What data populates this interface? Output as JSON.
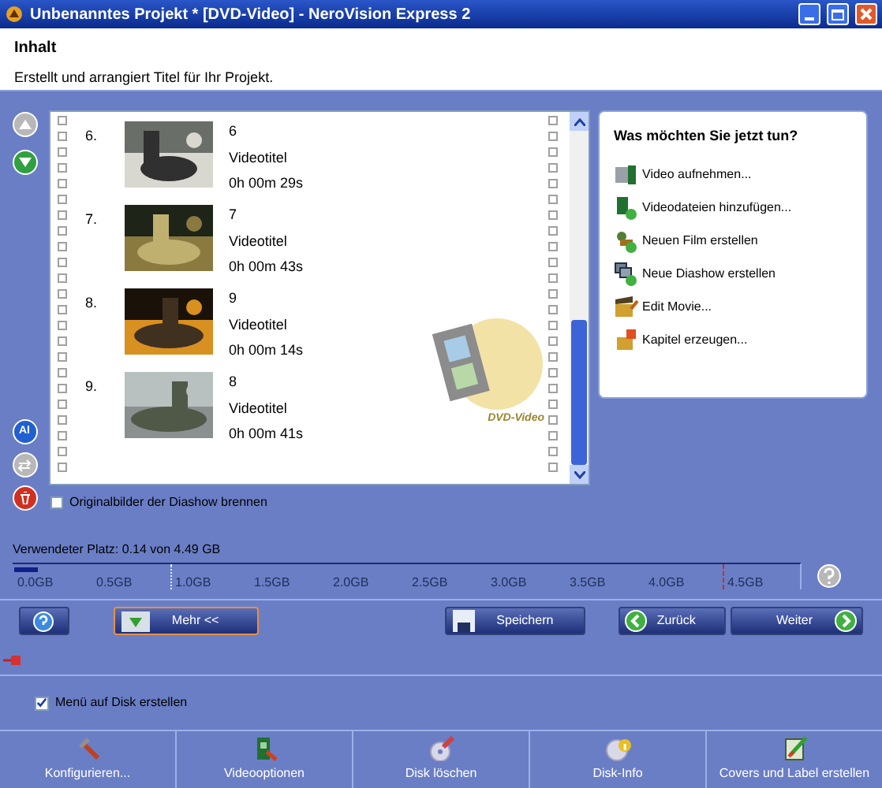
{
  "window": {
    "title": "Unbenanntes Projekt * [DVD-Video] - NeroVision Express 2"
  },
  "header": {
    "title": "Inhalt",
    "subtitle": "Erstellt und arrangiert Titel für Ihr Projekt."
  },
  "left_tools": [
    {
      "kind": "up",
      "disabled": true
    },
    {
      "kind": "down",
      "disabled": false
    },
    {
      "kind": "auto",
      "label": "AI",
      "disabled": false
    },
    {
      "kind": "swap",
      "disabled": true
    },
    {
      "kind": "delete",
      "disabled": false
    }
  ],
  "titles": [
    {
      "number": "6.",
      "name": "6",
      "type": "Videotitel",
      "duration": "0h 00m 29s"
    },
    {
      "number": "7.",
      "name": "7",
      "type": "Videotitel",
      "duration": "0h 00m 43s"
    },
    {
      "number": "8.",
      "name": "9",
      "type": "Videotitel",
      "duration": "0h 00m 14s"
    },
    {
      "number": "9.",
      "name": "8",
      "type": "Videotitel",
      "duration": "0h 00m 41s"
    }
  ],
  "list_logo": {
    "text": "DVD-Video"
  },
  "slideshow_option": {
    "label": "Originalbilder der Diashow brennen",
    "checked": false
  },
  "tasks": {
    "title": "Was möchten Sie jetzt tun?",
    "items": [
      "Video aufnehmen...",
      "Videodateien hinzufügen...",
      "Neuen Film erstellen",
      "Neue Diashow erstellen",
      "Edit Movie...",
      "Kapitel erzeugen..."
    ]
  },
  "disc_usage": {
    "label": "Verwendeter Platz: 0.14 von 4.49 GB",
    "level": 0.03,
    "scale_labels": [
      "0.0GB",
      "0.5GB",
      "1.0GB",
      "1.5GB",
      "2.0GB",
      "2.5GB",
      "3.0GB",
      "3.5GB",
      "4.0GB",
      "4.5GB"
    ]
  },
  "buttons": [
    {
      "kind": "help",
      "focused": false
    },
    {
      "kind": "more",
      "label": "Mehr <<",
      "focused": true
    },
    {
      "kind": "save",
      "label": "Speichern",
      "focused": false
    },
    {
      "kind": "back",
      "label": "Zurück",
      "focused": false
    },
    {
      "kind": "next",
      "label": "Weiter",
      "focused": false
    }
  ],
  "menu_option": {
    "label": "Menü auf Disk erstellen",
    "checked": true
  },
  "toolbar": [
    "Konfigurieren...",
    "Videooptionen",
    "Disk löschen",
    "Disk-Info",
    "Covers und Label erstellen"
  ]
}
